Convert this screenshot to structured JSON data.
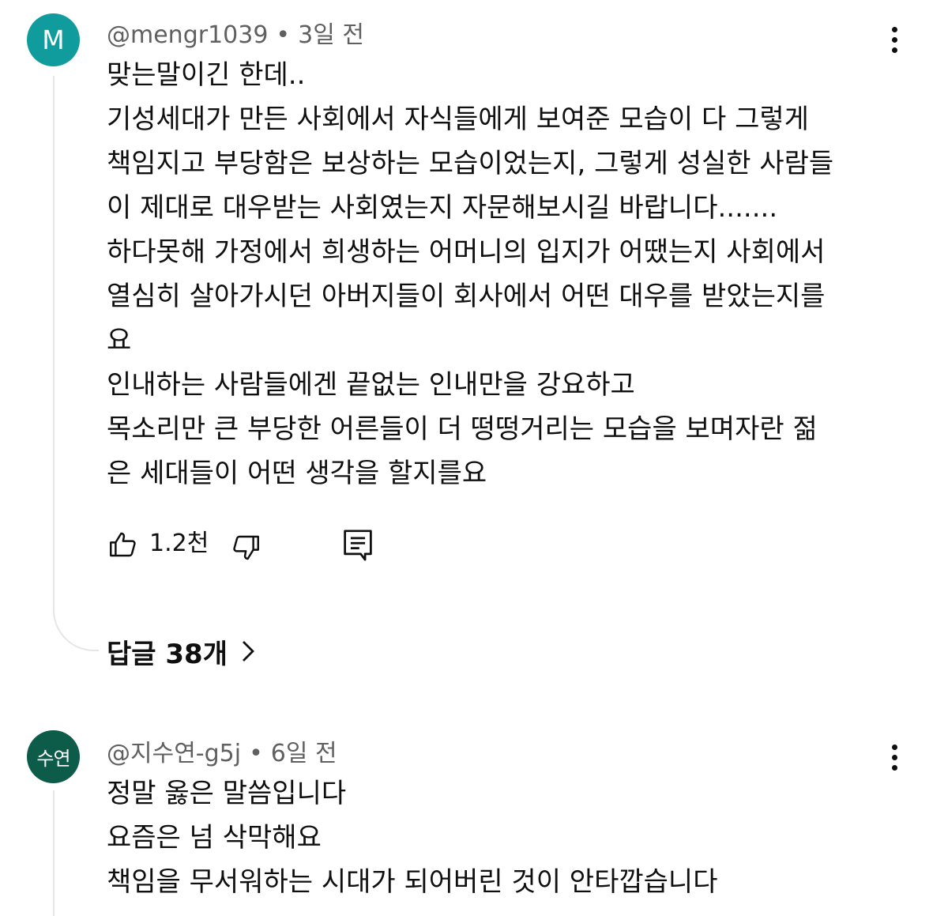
{
  "comments": [
    {
      "avatar_text": "M",
      "avatar_color": "#109c9c",
      "author": "@mengr1039",
      "separator": "•",
      "time": "3일 전",
      "lines": [
        "맞는말이긴 한데..",
        "기성세대가 만든 사회에서 자식들에게 보여준 모습이 다 그렇게",
        "책임지고 부당함은 보상하는 모습이었는지, 그렇게 성실한 사람들",
        "이 제대로 대우받는 사회였는지 자문해보시길 바랍니다.......",
        "하다못해 가정에서 희생하는 어머니의 입지가 어땠는지  사회에서",
        "열심히 살아가시던 아버지들이 회사에서 어떤 대우를 받았는지를",
        "요",
        "인내하는 사람들에겐 끝없는 인내만을 강요하고",
        "목소리만 큰 부당한 어른들이 더 떵떵거리는 모습을 보며자란 젊",
        "은 세대들이 어떤 생각을 할지를요"
      ],
      "like_count": "1.2천",
      "replies_label": "답글 38개",
      "icons": {
        "like": "thumb-up-icon",
        "dislike": "thumb-down-icon",
        "reply": "comment-icon",
        "more": "more-vert-icon",
        "chevron": "chevron-right-icon"
      }
    },
    {
      "avatar_text": "수연",
      "avatar_color": "#0d5b49",
      "author": "@지수연-g5j",
      "separator": "•",
      "time": "6일 전",
      "lines": [
        "정말 옳은 말씀입니다",
        "요즘은 넘 삭막해요",
        "책임을 무서워하는 시대가 되어버린 것이 안타깝습니다"
      ]
    }
  ]
}
